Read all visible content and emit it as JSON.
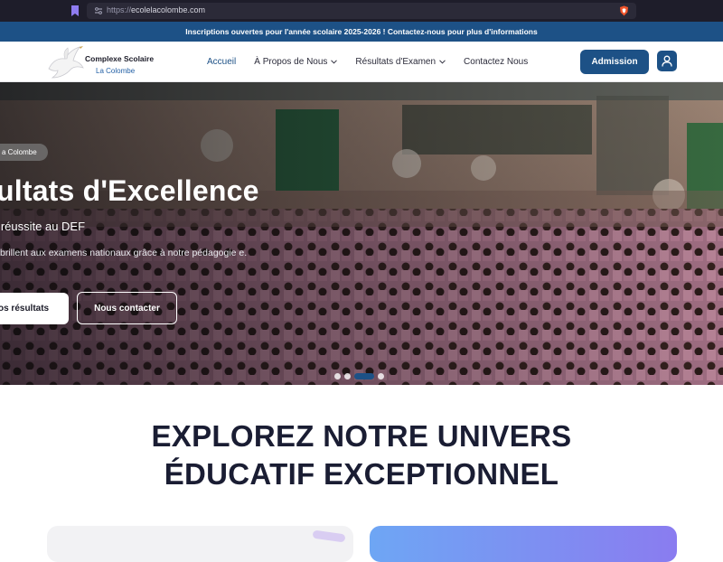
{
  "browser": {
    "url_scheme": "https://",
    "url_host": "ecolelacolombe.com"
  },
  "announcement": "Inscriptions ouvertes pour l'année scolaire 2025-2026 ! Contactez-nous pour plus d'informations",
  "logo": {
    "name": "Complexe Scolaire",
    "subname": "La Colombe"
  },
  "nav": {
    "items": [
      {
        "label": "Accueil",
        "active": true
      },
      {
        "label": "À Propos de Nous",
        "dropdown": true
      },
      {
        "label": "Résultats d'Examen",
        "dropdown": true
      },
      {
        "label": "Contactez Nous"
      }
    ],
    "admission_label": "Admission"
  },
  "hero": {
    "badge": "a Colombe",
    "title": "sultats d'Excellence",
    "subtitle": "e réussite au DEF",
    "description": "es brillent aux examens nationaux grâce à notre pédagogie e.",
    "primary_button": "nos résultats",
    "secondary_button": "Nous contacter",
    "slides_count": 4,
    "active_slide": 3
  },
  "explore": {
    "title_line1": "EXPLOREZ NOTRE UNIVERS",
    "title_line2": "ÉDUCATIF EXCEPTIONNEL"
  },
  "colors": {
    "brand": "#1d5186",
    "announcement_bg": "#1d5186",
    "heading": "#1a1d33"
  }
}
